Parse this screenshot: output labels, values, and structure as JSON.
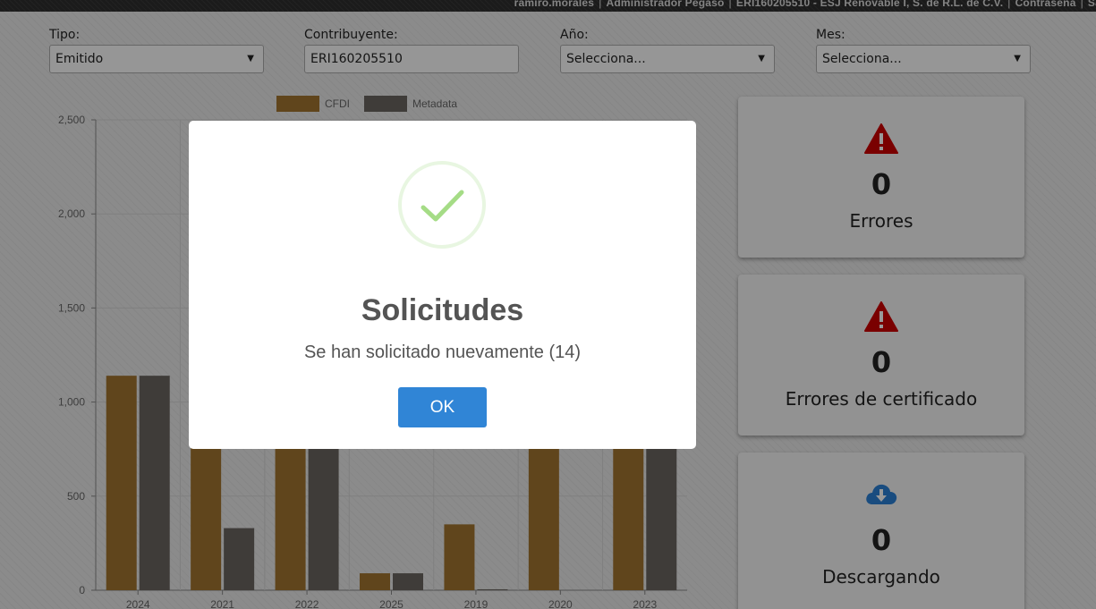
{
  "topbar": {
    "user": "ramiro.morales",
    "role": "Administrador Pegaso",
    "company": "ERI160205510 - ESJ Renovable I, S. de R.L. de C.V.",
    "password_link": "Contraseña",
    "exit_link": "Sa"
  },
  "filters": {
    "tipo": {
      "label": "Tipo:",
      "value": "Emitido"
    },
    "contribuyente": {
      "label": "Contribuyente:",
      "value": "ERI160205510"
    },
    "anio": {
      "label": "Año:",
      "value": "Selecciona..."
    },
    "mes": {
      "label": "Mes:",
      "value": "Selecciona..."
    }
  },
  "chart_data": {
    "type": "bar",
    "categories": [
      "2024",
      "2021",
      "2022",
      "2025",
      "2019",
      "2020",
      "2023"
    ],
    "series": [
      {
        "name": "CFDI",
        "color": "#a0732f",
        "values": [
          1140,
          800,
          800,
          90,
          350,
          800,
          800
        ]
      },
      {
        "name": "Metadata",
        "color": "#6a6560",
        "values": [
          1140,
          330,
          800,
          90,
          5,
          0,
          800
        ]
      }
    ],
    "yticks": [
      "2,500",
      "2,000",
      "1,500",
      "1,000",
      "500",
      "0"
    ],
    "ytick_values": [
      2500,
      2000,
      1500,
      1000,
      500,
      0
    ],
    "ylim": [
      0,
      2500
    ],
    "legend_position": "top",
    "grid": true
  },
  "cards": [
    {
      "count": "0",
      "label": "Errores",
      "icon": "warning-icon",
      "color": "#cc0000"
    },
    {
      "count": "0",
      "label": "Errores de certificado",
      "icon": "warning-icon",
      "color": "#cc0000"
    },
    {
      "count": "0",
      "label": "Descargando",
      "icon": "cloud-download-icon",
      "color": "#2a7fd4"
    }
  ],
  "modal": {
    "title": "Solicitudes",
    "message": "Se han solicitado nuevamente (14)",
    "ok_label": "OK",
    "icon": "success-check-icon",
    "accent": "#3085d6",
    "check_color": "#a5dc86"
  }
}
